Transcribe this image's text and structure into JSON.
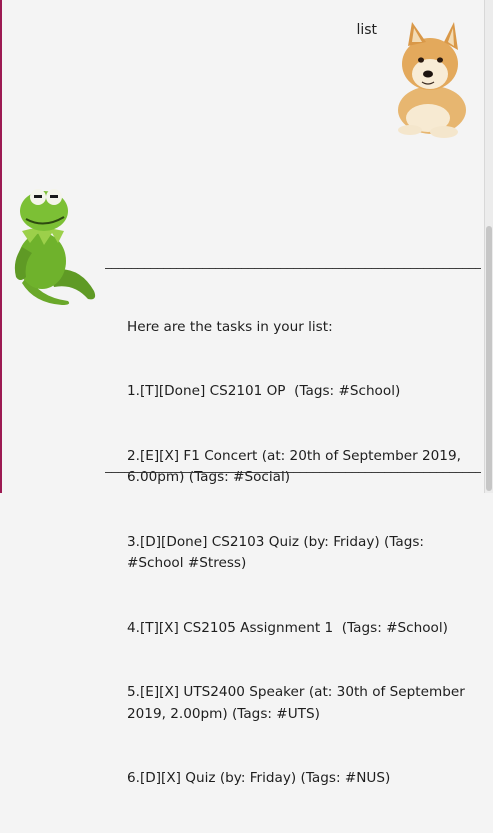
{
  "user_message": {
    "text": "list"
  },
  "bot_message": {
    "divider": "_______________________________________________________________",
    "header": "Here are the tasks in your list:",
    "tasks": [
      "1.[T][Done] CS2101 OP  (Tags: #School)",
      "2.[E][X] F1 Concert (at: 20th of September 2019, 6.00pm) (Tags: #Social)",
      "3.[D][Done] CS2103 Quiz (by: Friday) (Tags: #School #Stress)",
      "4.[T][X] CS2105 Assignment 1  (Tags: #School)",
      "5.[E][X] UTS2400 Speaker (at: 30th of September 2019, 2.00pm) (Tags: #UTS)",
      "6.[D][X] Quiz (by: Friday) (Tags: #NUS)"
    ],
    "divider_bottom": "_______________________________________________________________"
  },
  "colors": {
    "left_border": "#9c1a52",
    "background": "#f4f4f4",
    "text": "#1e1e1e"
  },
  "avatars": {
    "user": "doge-avatar",
    "bot": "kermit-avatar"
  }
}
